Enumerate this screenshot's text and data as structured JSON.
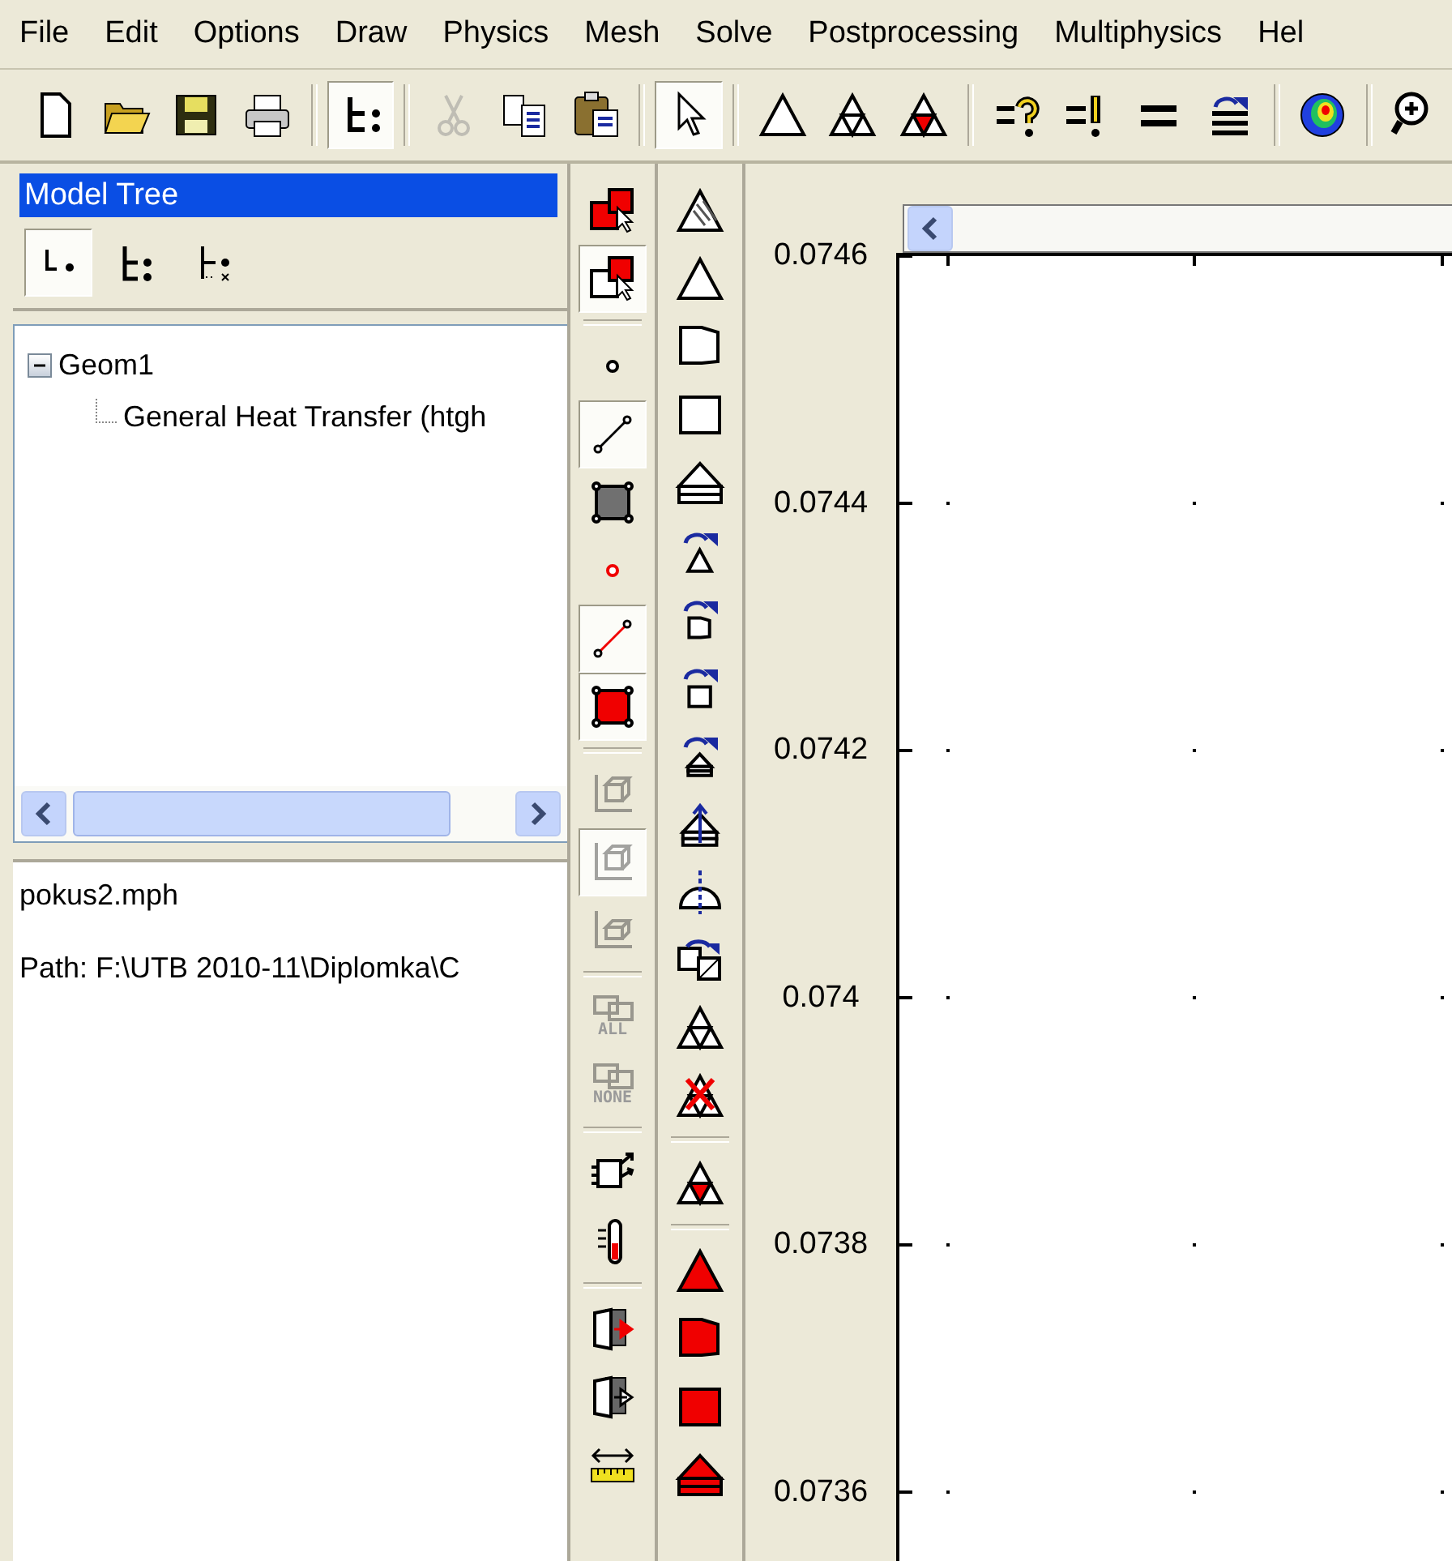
{
  "menu": [
    {
      "label": "File"
    },
    {
      "label": "Edit"
    },
    {
      "label": "Options"
    },
    {
      "label": "Draw"
    },
    {
      "label": "Physics"
    },
    {
      "label": "Mesh"
    },
    {
      "label": "Solve"
    },
    {
      "label": "Postprocessing"
    },
    {
      "label": "Multiphysics"
    },
    {
      "label": "Hel"
    }
  ],
  "toolbar": [
    {
      "kind": "new",
      "pressed": false,
      "disabled": false
    },
    {
      "kind": "open",
      "pressed": false,
      "disabled": false
    },
    {
      "kind": "save",
      "pressed": false,
      "disabled": false
    },
    {
      "kind": "print",
      "pressed": false,
      "disabled": false
    },
    {
      "kind": "separator"
    },
    {
      "kind": "tree",
      "pressed": true,
      "disabled": false
    },
    {
      "kind": "separator"
    },
    {
      "kind": "cut",
      "pressed": false,
      "disabled": true
    },
    {
      "kind": "copy",
      "pressed": false,
      "disabled": false
    },
    {
      "kind": "paste",
      "pressed": false,
      "disabled": false
    },
    {
      "kind": "separator"
    },
    {
      "kind": "pointer",
      "pressed": true,
      "disabled": false
    },
    {
      "kind": "separator"
    },
    {
      "kind": "tri",
      "pressed": false,
      "disabled": false
    },
    {
      "kind": "tri-split",
      "pressed": false,
      "disabled": false
    },
    {
      "kind": "tri-mark",
      "pressed": false,
      "disabled": false
    },
    {
      "kind": "separator"
    },
    {
      "kind": "point-eq",
      "pressed": false,
      "disabled": false
    },
    {
      "kind": "edge-eq",
      "pressed": false,
      "disabled": false
    },
    {
      "kind": "equal",
      "pressed": false,
      "disabled": false
    },
    {
      "kind": "sub-eq",
      "pressed": false,
      "disabled": false
    },
    {
      "kind": "separator"
    },
    {
      "kind": "color-plot",
      "pressed": false,
      "disabled": false
    },
    {
      "kind": "separator"
    },
    {
      "kind": "zoom",
      "pressed": false,
      "disabled": false
    }
  ],
  "model_tree": {
    "title": "Model Tree",
    "view_buttons": [
      {
        "kind": "tree-leaf",
        "selected": true
      },
      {
        "kind": "tree-full",
        "selected": false
      },
      {
        "kind": "tree-detail",
        "selected": false
      }
    ],
    "nodes": [
      {
        "label": "Geom1",
        "expanded": true,
        "children": [
          {
            "label": "General Heat Transfer (htgh"
          }
        ]
      }
    ]
  },
  "info": {
    "file": "pokus2.mph",
    "path": "Path: F:\\UTB 2010-11\\Diplomka\\C"
  },
  "draw_toolbar": [
    {
      "kind": "select-filled",
      "pressed": false,
      "disabled": false
    },
    {
      "kind": "select-outline",
      "pressed": true,
      "disabled": false
    },
    {
      "kind": "separator"
    },
    {
      "kind": "point",
      "pressed": false,
      "disabled": false
    },
    {
      "kind": "line",
      "pressed": true,
      "disabled": false
    },
    {
      "kind": "square",
      "pressed": false,
      "disabled": false
    },
    {
      "kind": "point-red",
      "pressed": false,
      "disabled": false
    },
    {
      "kind": "line-red",
      "pressed": true,
      "disabled": false
    },
    {
      "kind": "square-red",
      "pressed": true,
      "disabled": false
    },
    {
      "kind": "separator"
    },
    {
      "kind": "axes-box",
      "pressed": false,
      "disabled": true
    },
    {
      "kind": "axes-box-2",
      "pressed": true,
      "disabled": true
    },
    {
      "kind": "axes-box-3",
      "pressed": false,
      "disabled": true
    },
    {
      "kind": "separator"
    },
    {
      "kind": "select-all",
      "label": "ALL",
      "pressed": false,
      "disabled": true
    },
    {
      "kind": "select-none",
      "label": "NONE",
      "pressed": false,
      "disabled": true
    },
    {
      "kind": "separator"
    },
    {
      "kind": "export",
      "pressed": false,
      "disabled": false
    },
    {
      "kind": "thermo",
      "pressed": false,
      "disabled": false
    },
    {
      "kind": "separator"
    },
    {
      "kind": "door-in",
      "pressed": false,
      "disabled": false
    },
    {
      "kind": "door-out",
      "pressed": false,
      "disabled": false
    },
    {
      "kind": "ruler",
      "pressed": false,
      "disabled": false
    }
  ],
  "mesh_toolbar": [
    {
      "kind": "hatch-tri",
      "pressed": false,
      "disabled": false
    },
    {
      "kind": "m-tri",
      "pressed": false,
      "disabled": false
    },
    {
      "kind": "m-trap",
      "pressed": false,
      "disabled": false
    },
    {
      "kind": "m-sq",
      "pressed": false,
      "disabled": false
    },
    {
      "kind": "m-prism",
      "pressed": false,
      "disabled": false
    },
    {
      "kind": "rot-tri",
      "pressed": false,
      "disabled": false
    },
    {
      "kind": "rot-trap",
      "pressed": false,
      "disabled": false
    },
    {
      "kind": "rot-sq",
      "pressed": false,
      "disabled": false
    },
    {
      "kind": "rot-prism",
      "pressed": false,
      "disabled": false
    },
    {
      "kind": "extrude",
      "pressed": false,
      "disabled": false
    },
    {
      "kind": "revolve",
      "pressed": false,
      "disabled": false
    },
    {
      "kind": "copy-mesh",
      "pressed": false,
      "disabled": false
    },
    {
      "kind": "tri-split",
      "pressed": false,
      "disabled": false
    },
    {
      "kind": "del-mesh",
      "pressed": false,
      "disabled": false
    },
    {
      "kind": "separator"
    },
    {
      "kind": "tri-mark",
      "pressed": false,
      "disabled": false
    },
    {
      "kind": "separator"
    },
    {
      "kind": "r-tri",
      "pressed": false,
      "disabled": false
    },
    {
      "kind": "r-trap",
      "pressed": false,
      "disabled": false
    },
    {
      "kind": "r-sq",
      "pressed": false,
      "disabled": false
    },
    {
      "kind": "r-prism",
      "pressed": false,
      "disabled": false
    }
  ],
  "plot": {
    "y_ticks": [
      "0.0746",
      "0.0744",
      "0.0742",
      "0.074",
      "0.0738",
      "0.0736"
    ]
  }
}
